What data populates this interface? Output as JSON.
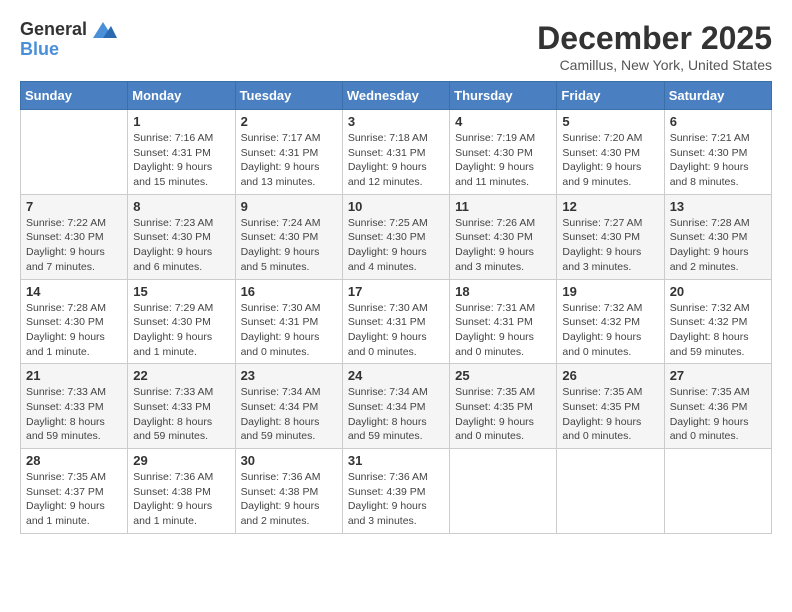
{
  "logo": {
    "line1": "General",
    "line2": "Blue"
  },
  "title": "December 2025",
  "location": "Camillus, New York, United States",
  "days_of_week": [
    "Sunday",
    "Monday",
    "Tuesday",
    "Wednesday",
    "Thursday",
    "Friday",
    "Saturday"
  ],
  "weeks": [
    [
      {
        "number": "",
        "info": ""
      },
      {
        "number": "1",
        "info": "Sunrise: 7:16 AM\nSunset: 4:31 PM\nDaylight: 9 hours\nand 15 minutes."
      },
      {
        "number": "2",
        "info": "Sunrise: 7:17 AM\nSunset: 4:31 PM\nDaylight: 9 hours\nand 13 minutes."
      },
      {
        "number": "3",
        "info": "Sunrise: 7:18 AM\nSunset: 4:31 PM\nDaylight: 9 hours\nand 12 minutes."
      },
      {
        "number": "4",
        "info": "Sunrise: 7:19 AM\nSunset: 4:30 PM\nDaylight: 9 hours\nand 11 minutes."
      },
      {
        "number": "5",
        "info": "Sunrise: 7:20 AM\nSunset: 4:30 PM\nDaylight: 9 hours\nand 9 minutes."
      },
      {
        "number": "6",
        "info": "Sunrise: 7:21 AM\nSunset: 4:30 PM\nDaylight: 9 hours\nand 8 minutes."
      }
    ],
    [
      {
        "number": "7",
        "info": "Sunrise: 7:22 AM\nSunset: 4:30 PM\nDaylight: 9 hours\nand 7 minutes."
      },
      {
        "number": "8",
        "info": "Sunrise: 7:23 AM\nSunset: 4:30 PM\nDaylight: 9 hours\nand 6 minutes."
      },
      {
        "number": "9",
        "info": "Sunrise: 7:24 AM\nSunset: 4:30 PM\nDaylight: 9 hours\nand 5 minutes."
      },
      {
        "number": "10",
        "info": "Sunrise: 7:25 AM\nSunset: 4:30 PM\nDaylight: 9 hours\nand 4 minutes."
      },
      {
        "number": "11",
        "info": "Sunrise: 7:26 AM\nSunset: 4:30 PM\nDaylight: 9 hours\nand 3 minutes."
      },
      {
        "number": "12",
        "info": "Sunrise: 7:27 AM\nSunset: 4:30 PM\nDaylight: 9 hours\nand 3 minutes."
      },
      {
        "number": "13",
        "info": "Sunrise: 7:28 AM\nSunset: 4:30 PM\nDaylight: 9 hours\nand 2 minutes."
      }
    ],
    [
      {
        "number": "14",
        "info": "Sunrise: 7:28 AM\nSunset: 4:30 PM\nDaylight: 9 hours\nand 1 minute."
      },
      {
        "number": "15",
        "info": "Sunrise: 7:29 AM\nSunset: 4:30 PM\nDaylight: 9 hours\nand 1 minute."
      },
      {
        "number": "16",
        "info": "Sunrise: 7:30 AM\nSunset: 4:31 PM\nDaylight: 9 hours\nand 0 minutes."
      },
      {
        "number": "17",
        "info": "Sunrise: 7:30 AM\nSunset: 4:31 PM\nDaylight: 9 hours\nand 0 minutes."
      },
      {
        "number": "18",
        "info": "Sunrise: 7:31 AM\nSunset: 4:31 PM\nDaylight: 9 hours\nand 0 minutes."
      },
      {
        "number": "19",
        "info": "Sunrise: 7:32 AM\nSunset: 4:32 PM\nDaylight: 9 hours\nand 0 minutes."
      },
      {
        "number": "20",
        "info": "Sunrise: 7:32 AM\nSunset: 4:32 PM\nDaylight: 8 hours\nand 59 minutes."
      }
    ],
    [
      {
        "number": "21",
        "info": "Sunrise: 7:33 AM\nSunset: 4:33 PM\nDaylight: 8 hours\nand 59 minutes."
      },
      {
        "number": "22",
        "info": "Sunrise: 7:33 AM\nSunset: 4:33 PM\nDaylight: 8 hours\nand 59 minutes."
      },
      {
        "number": "23",
        "info": "Sunrise: 7:34 AM\nSunset: 4:34 PM\nDaylight: 8 hours\nand 59 minutes."
      },
      {
        "number": "24",
        "info": "Sunrise: 7:34 AM\nSunset: 4:34 PM\nDaylight: 8 hours\nand 59 minutes."
      },
      {
        "number": "25",
        "info": "Sunrise: 7:35 AM\nSunset: 4:35 PM\nDaylight: 9 hours\nand 0 minutes."
      },
      {
        "number": "26",
        "info": "Sunrise: 7:35 AM\nSunset: 4:35 PM\nDaylight: 9 hours\nand 0 minutes."
      },
      {
        "number": "27",
        "info": "Sunrise: 7:35 AM\nSunset: 4:36 PM\nDaylight: 9 hours\nand 0 minutes."
      }
    ],
    [
      {
        "number": "28",
        "info": "Sunrise: 7:35 AM\nSunset: 4:37 PM\nDaylight: 9 hours\nand 1 minute."
      },
      {
        "number": "29",
        "info": "Sunrise: 7:36 AM\nSunset: 4:38 PM\nDaylight: 9 hours\nand 1 minute."
      },
      {
        "number": "30",
        "info": "Sunrise: 7:36 AM\nSunset: 4:38 PM\nDaylight: 9 hours\nand 2 minutes."
      },
      {
        "number": "31",
        "info": "Sunrise: 7:36 AM\nSunset: 4:39 PM\nDaylight: 9 hours\nand 3 minutes."
      },
      {
        "number": "",
        "info": ""
      },
      {
        "number": "",
        "info": ""
      },
      {
        "number": "",
        "info": ""
      }
    ]
  ]
}
